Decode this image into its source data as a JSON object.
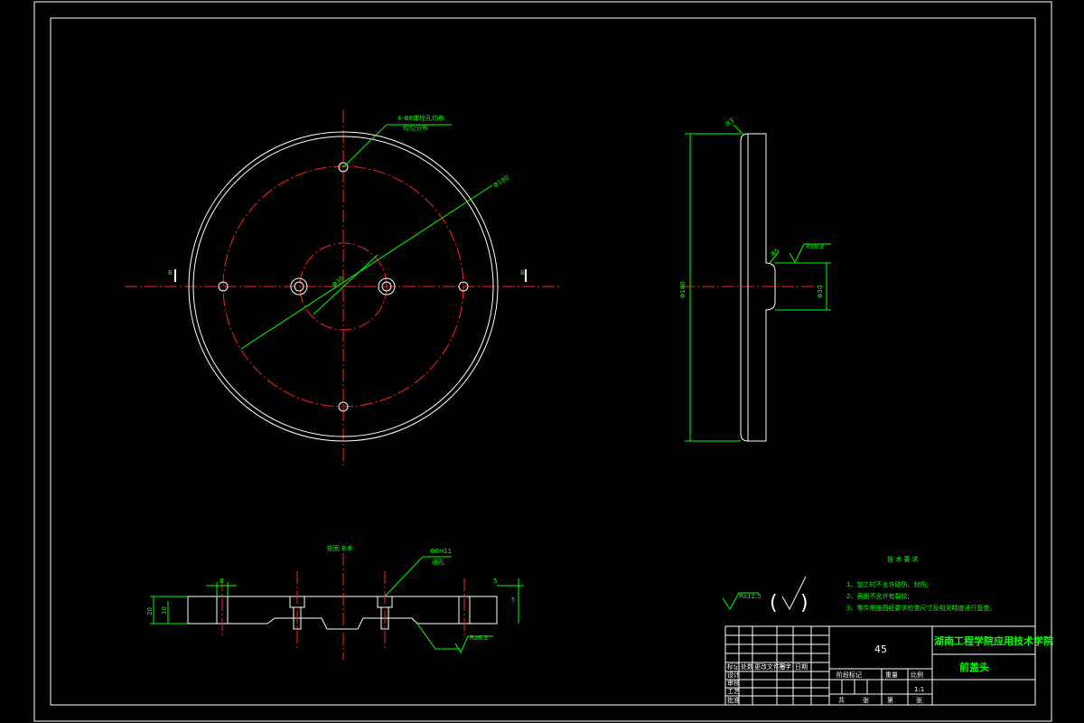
{
  "front_view": {
    "pcd_note_line1": "4-Φ8螺栓孔均布",
    "pcd_note_line2": "均匀分布",
    "dia_outer": "Φ180",
    "dia_inner": "Φ30",
    "section_mark_left": "B",
    "section_mark_right": "B"
  },
  "side_view": {
    "height_dim": "Φ180",
    "fillet_label": "R3",
    "chamfer_label": "R5",
    "boss_dim": "Φ30",
    "roughness_label": "Ra6.3"
  },
  "section_view": {
    "title": "剖面 B-B",
    "hole_note_line1": "Φ8H11",
    "hole_note_line2": "通孔",
    "left_dim": "8",
    "right_dim_top": "5",
    "right_dim_bottom": "5",
    "height_outer": "20",
    "height_inner": "10",
    "roughness_label": "Ra6.3"
  },
  "surface_finish": {
    "label": "Ra12.5",
    "paren_open": "(",
    "paren_close": ")"
  },
  "tech_requirements": {
    "title": "技 术 要 求",
    "items": [
      "1、加工时不允许碰伤、划伤;",
      "2、表面不允许有裂纹;",
      "3、零件需按图纸要求检查尺寸及相关精度进行复查。"
    ]
  },
  "title_block": {
    "material": "45",
    "school": "湖南工程学院应用技术学院",
    "part_name": "前盖头",
    "scale": "1:1",
    "header_labels": [
      "标记",
      "处数",
      "更改文件号",
      "签字",
      "日期"
    ],
    "sub_labels": [
      "阶段标记",
      "重量",
      "比例"
    ],
    "bottom_labels": [
      "共",
      "张",
      "第",
      "张"
    ],
    "row_labels": [
      "设计",
      "审核",
      "工艺",
      "批准"
    ]
  }
}
